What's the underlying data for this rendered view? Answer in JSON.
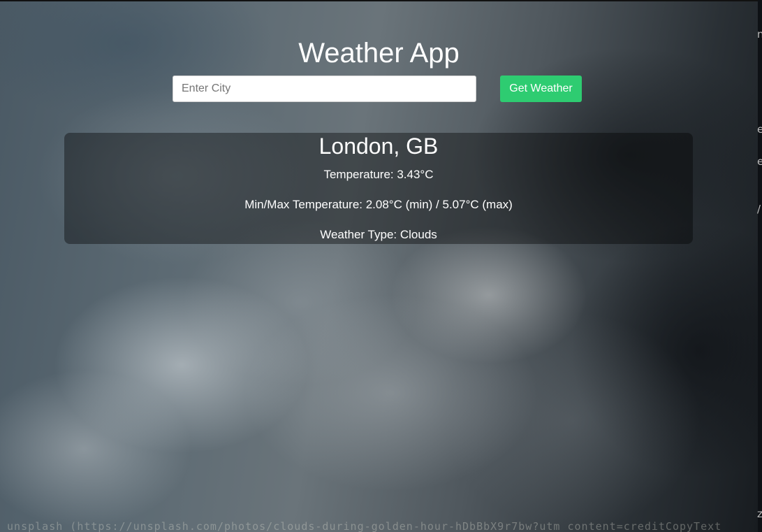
{
  "app": {
    "title": "Weather App"
  },
  "search": {
    "placeholder": "Enter City",
    "value": "",
    "button_label": "Get Weather"
  },
  "weather": {
    "location": "London, GB",
    "temperature_line": "Temperature: 3.43°C",
    "minmax_line": "Min/Max Temperature: 2.08°C (min) / 5.07°C (max)",
    "type_line": "Weather Type: Clouds"
  },
  "colors": {
    "button_bg": "#2ecc71",
    "text": "#ffffff",
    "card_bg": "rgba(0,0,0,0.38)"
  }
}
